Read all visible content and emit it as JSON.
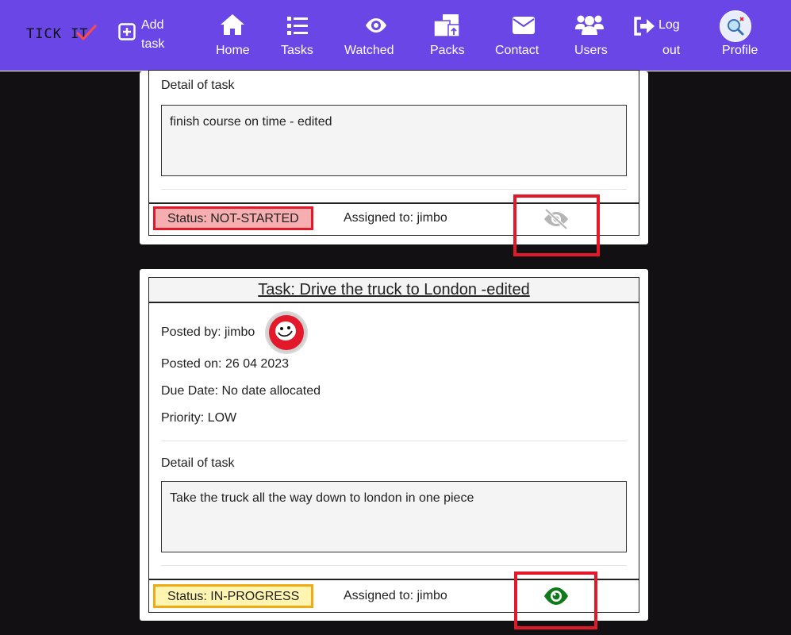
{
  "nav": {
    "brand": "TICK IT",
    "add_task_line1": "Add",
    "add_task_line2": "task",
    "home": "Home",
    "tasks": "Tasks",
    "watched": "Watched",
    "packs": "Packs",
    "contact": "Contact",
    "users": "Users",
    "logout_line1": "Log",
    "logout_line2": "out",
    "profile": "Profile"
  },
  "card1": {
    "detail_label": "Detail of task",
    "detail_text": "finish course on time - edited",
    "status": "Status: NOT-STARTED",
    "assigned": "Assigned to: jimbo",
    "watch_icon": "eye-slash-icon"
  },
  "card2": {
    "title": "Task: Drive the truck to London -edited",
    "posted_by": "Posted by: jimbo",
    "posted_on": "Posted on: 26 04 2023",
    "due_date": "Due Date: No date allocated",
    "priority": "Priority: LOW",
    "detail_label": "Detail of task",
    "detail_text": "Take the truck all the way down to london in one piece",
    "status": "Status: IN-PROGRESS",
    "assigned": "Assigned to: jimbo",
    "watch_icon": "eye-icon"
  },
  "colors": {
    "nav_bg": "#6a46e6",
    "page_bg": "#121013",
    "not_started_bg": "#f6aeb0",
    "not_started_border": "#e3182b",
    "in_progress_bg": "#fff4b0",
    "in_progress_border": "#f0aa12",
    "watched_icon": "#0f7a1a",
    "unwatched_icon": "#b5b5b5",
    "annotation_red": "#e3182b"
  }
}
